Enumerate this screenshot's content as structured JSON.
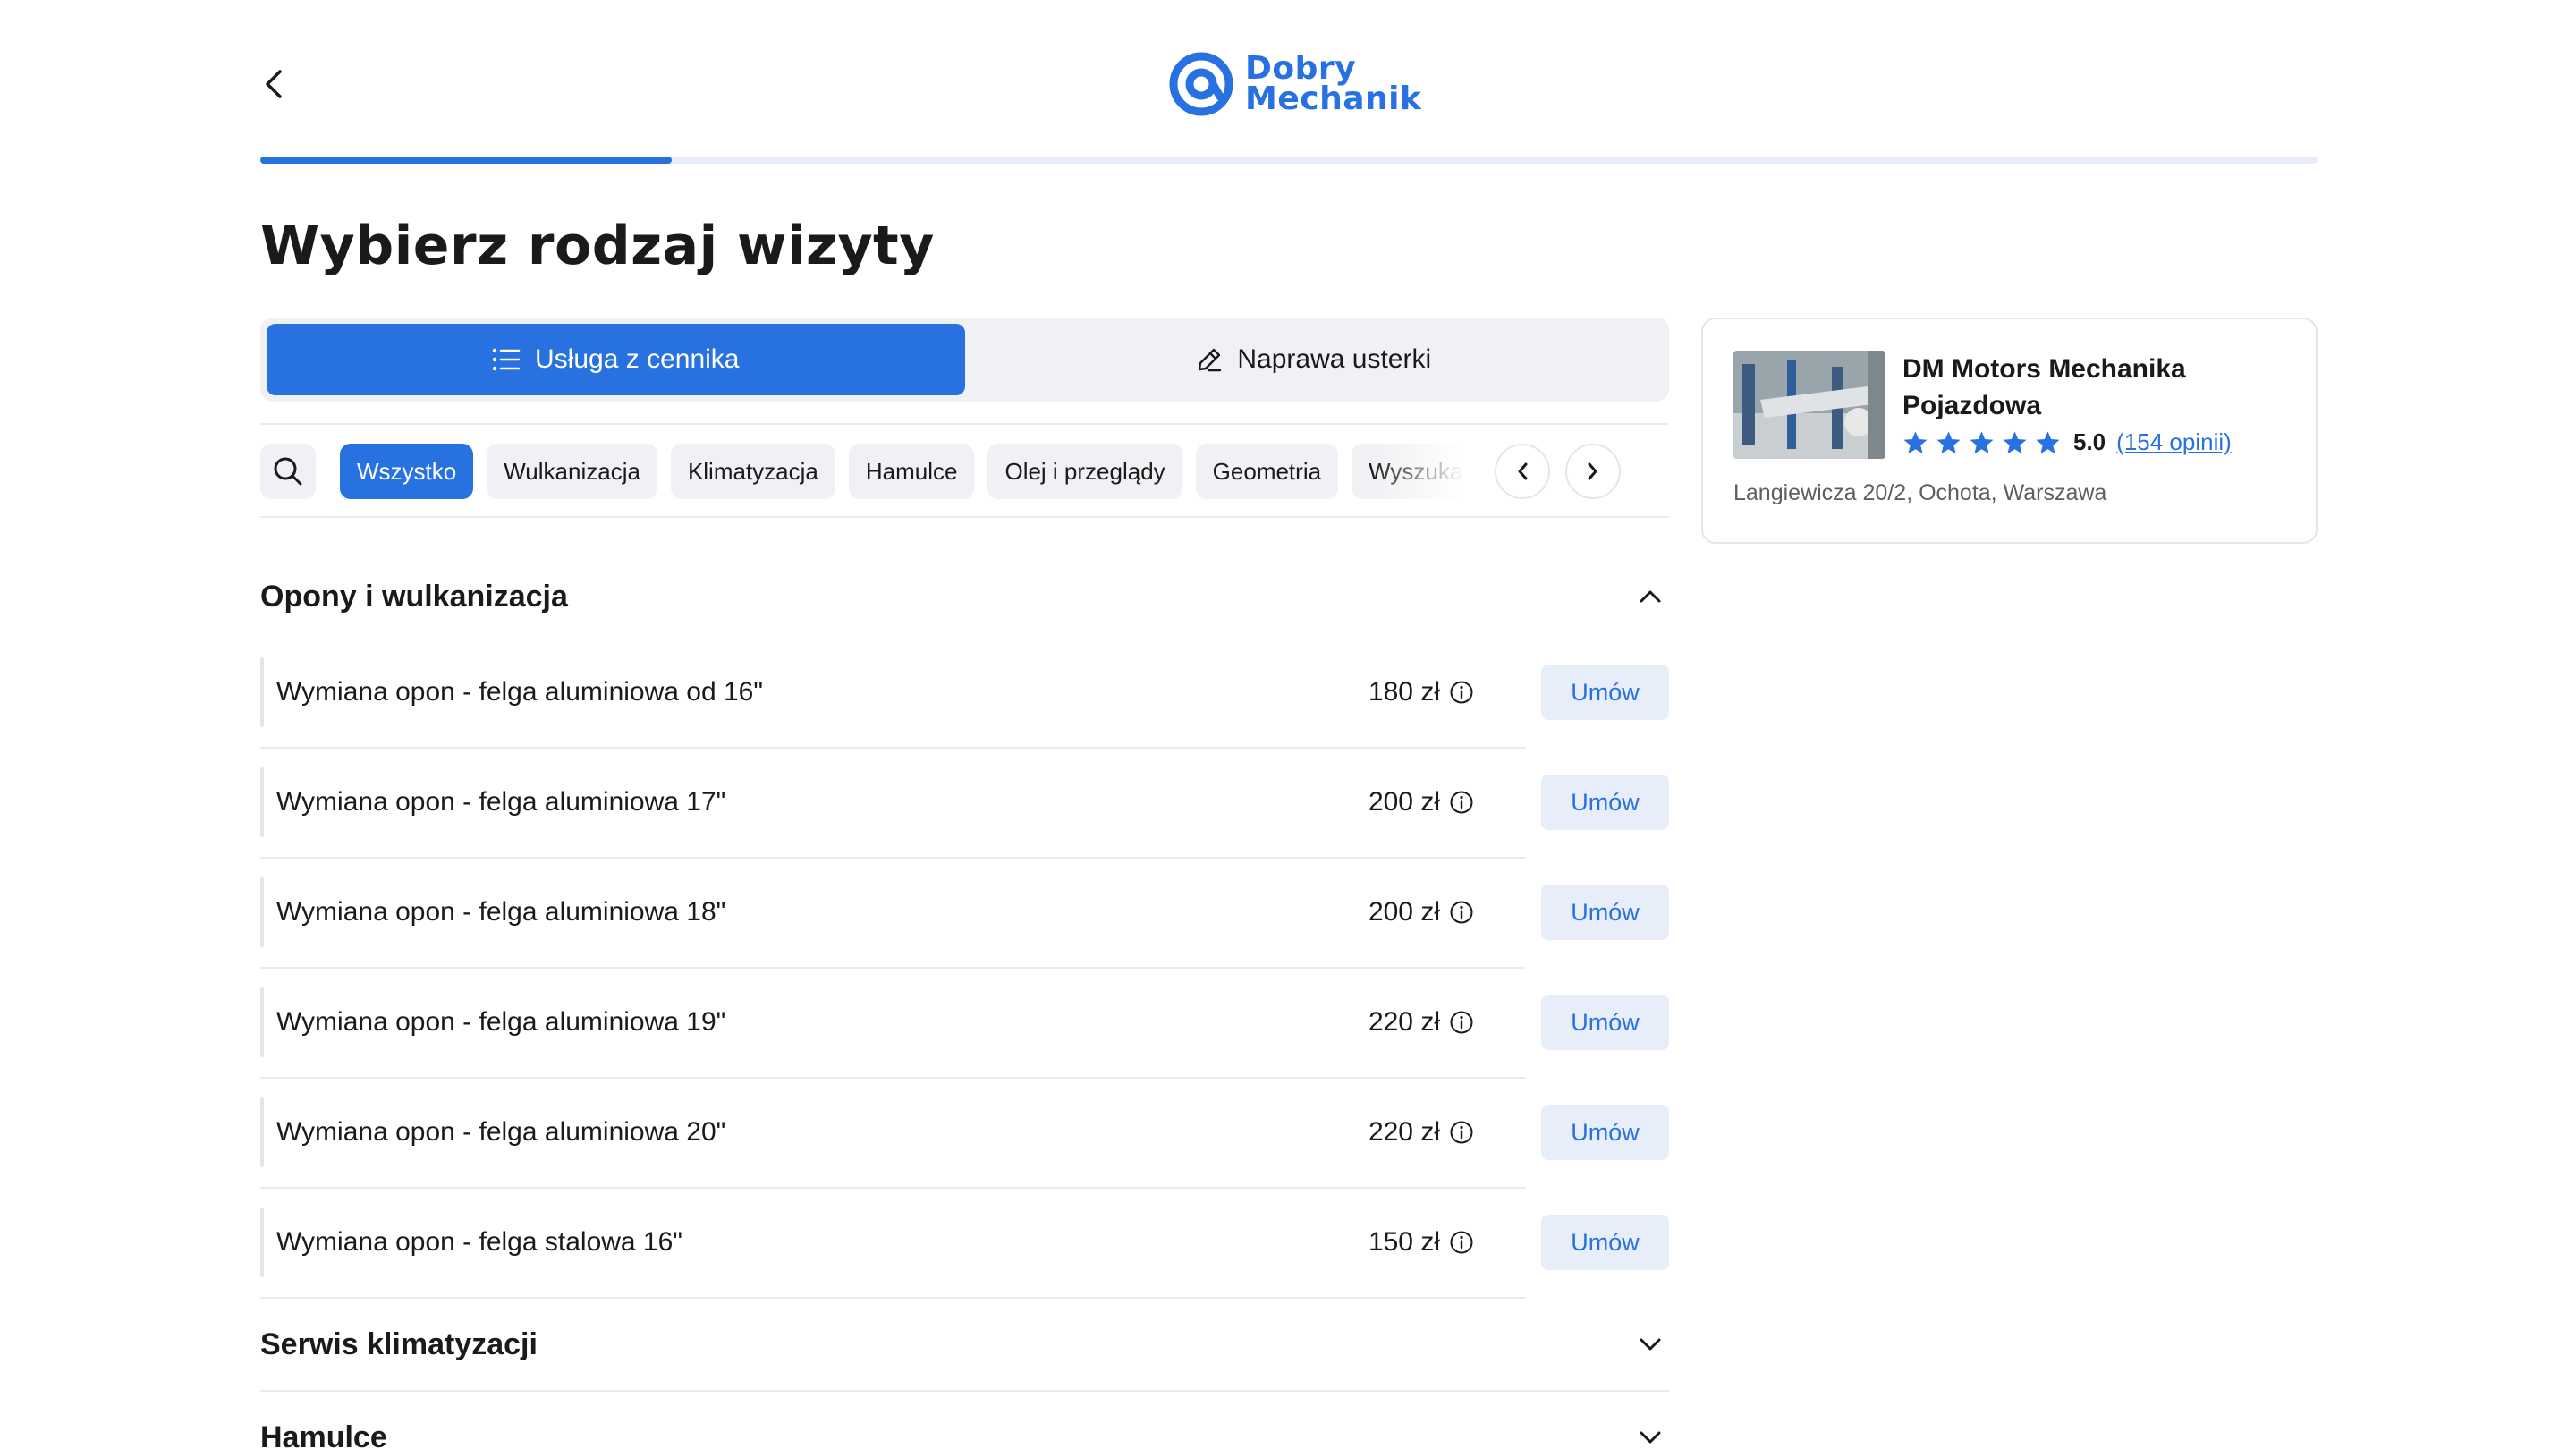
{
  "header": {
    "logo_line1": "Dobry",
    "logo_line2": "Mechanik",
    "progress": 0.2
  },
  "page_title": "Wybierz rodzaj wizyty",
  "toggle": {
    "option1": "Usługa z cennika",
    "option2": "Naprawa usterki",
    "active": "option1"
  },
  "chips": [
    "Wszystko",
    "Wulkanizacja",
    "Klimatyzacja",
    "Hamulce",
    "Olej i przeglądy",
    "Geometria",
    "Wyszukaj"
  ],
  "sections": {
    "tires": {
      "title": "Opony i wulkanizacja",
      "book_label": "Umów",
      "items": [
        {
          "name": "Wymiana opon - felga aluminiowa od 16\"",
          "price": "180 zł"
        },
        {
          "name": "Wymiana opon - felga aluminiowa 17\"",
          "price": "200 zł"
        },
        {
          "name": "Wymiana opon - felga aluminiowa 18\"",
          "price": "200 zł"
        },
        {
          "name": "Wymiana opon - felga aluminiowa 19\"",
          "price": "220 zł"
        },
        {
          "name": "Wymiana opon - felga aluminiowa 20\"",
          "price": "220 zł"
        },
        {
          "name": "Wymiana opon - felga stalowa 16\"",
          "price": "150 zł"
        }
      ]
    },
    "ac": {
      "title": "Serwis klimatyzacji"
    },
    "brakes": {
      "title": "Hamulce"
    }
  },
  "workshop": {
    "name": "DM Motors Mechanika Pojazdowa",
    "rating": "5.0",
    "stars": 5,
    "reviews": "(154 opinii)",
    "address": "Langiewicza 20/2, Ochota, Warszawa"
  },
  "colors": {
    "accent": "#2871e0",
    "accent_light": "#e7eef9",
    "chip_bg": "#f0f1f4"
  }
}
